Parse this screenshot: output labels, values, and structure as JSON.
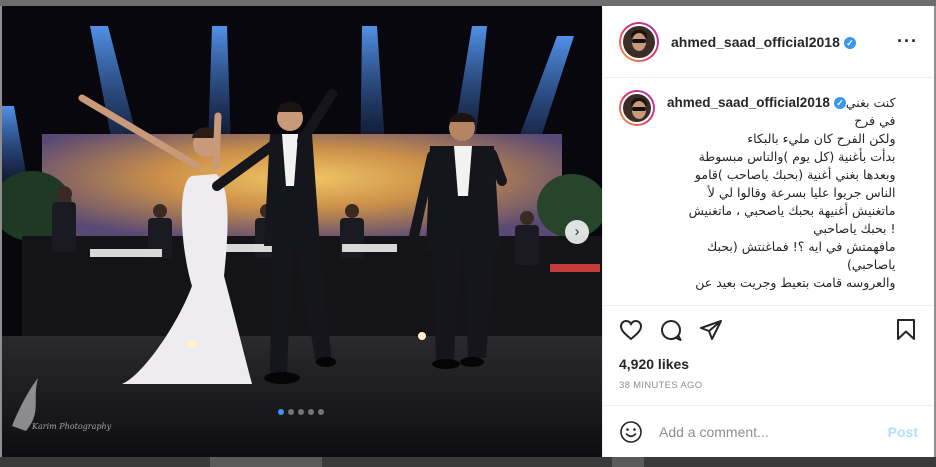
{
  "post": {
    "username": "ahmed_saad_official2018",
    "verified": true,
    "caption_first_line": "كنت بغني",
    "caption_lines": [
      "في فرح",
      "ولكن الفرح كان مليء بالبكاء",
      "بدأت بأغنية (كل يوم )والناس مبسوطة",
      "وبعدها بغني أغنية (بحبك ياصاحب )قامو",
      "الناس جريوا عليا بسرعة وقالوا لي لأ",
      "ماتغنيش أغنيهة بحبك ياصحبي ، ماتغنيش",
      "! بحبك ياصاحبي",
      "مافهمتش في ايه ؟! فماغنتش (بحبك",
      "ياصاحبي)",
      "والعروسه قامت بتعيط وجريت بعيد عن"
    ],
    "likes": "4,920 likes",
    "timestamp": "38 MINUTES AGO"
  },
  "comment_box": {
    "placeholder": "Add a comment...",
    "post_label": "Post"
  },
  "carousel": {
    "total": 5,
    "active_index": 0
  },
  "photo": {
    "watermark": "Karim Photography"
  },
  "colors": {
    "accent": "#3897f0",
    "post_disabled": "#b2dffc",
    "text": "#262626",
    "muted": "#8e8e8e"
  },
  "icons": [
    "heart-icon",
    "comment-icon",
    "share-icon",
    "bookmark-icon",
    "more-icon",
    "emoji-icon",
    "chevron-right-icon",
    "verified-badge-icon"
  ]
}
